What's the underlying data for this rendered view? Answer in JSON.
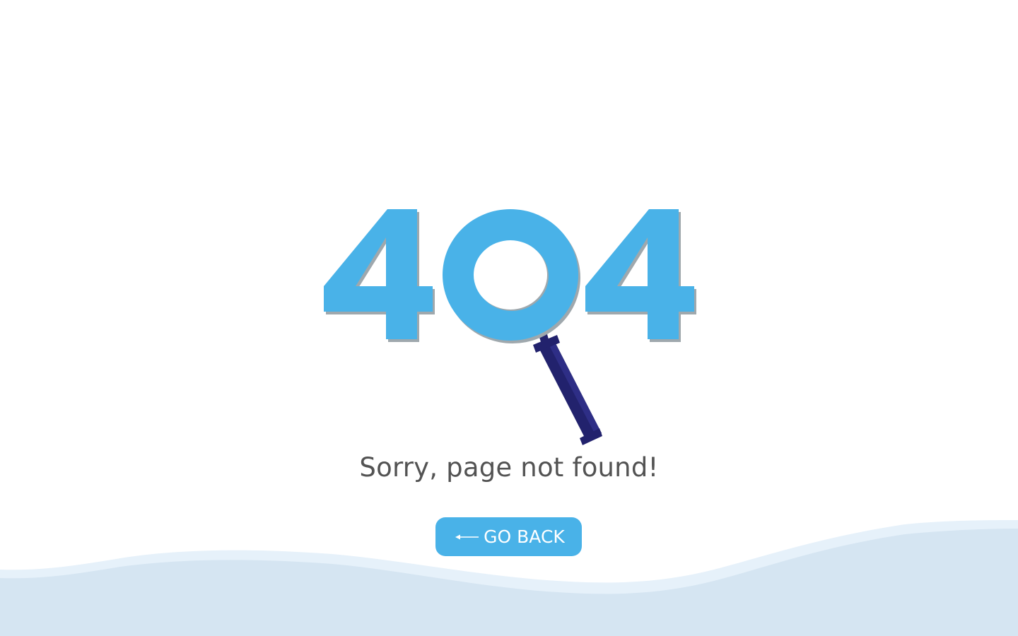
{
  "error": {
    "code": "404",
    "message": "Sorry, page not found!"
  },
  "actions": {
    "go_back_label": "GO BACK",
    "go_back_icon": "arrow-left-icon"
  },
  "colors": {
    "accent": "#49b2e8",
    "digit_shadow": "#9fa8ad",
    "magnifier_handle": "#22226d",
    "magnifier_handle_light": "#2e2e86",
    "wave_light": "#e6f1fa",
    "wave_dark": "#d5e5f2",
    "message_text": "#535353",
    "background": "#ffffff"
  }
}
